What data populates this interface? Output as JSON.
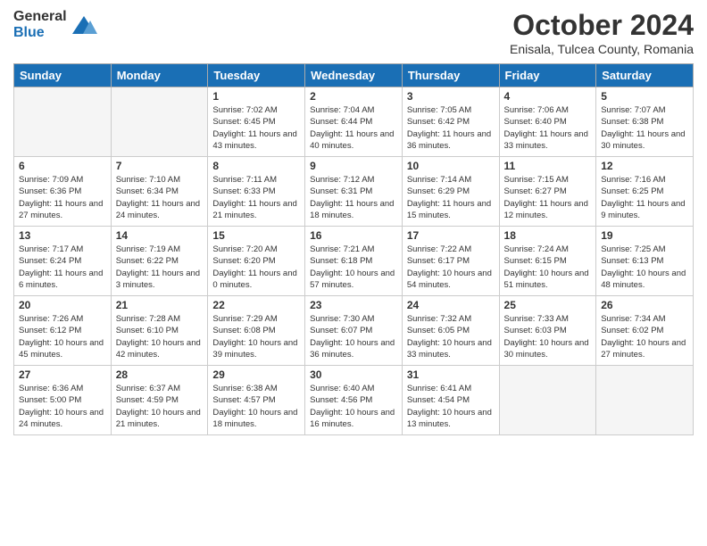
{
  "header": {
    "logo_general": "General",
    "logo_blue": "Blue",
    "month_title": "October 2024",
    "subtitle": "Enisala, Tulcea County, Romania"
  },
  "days_of_week": [
    "Sunday",
    "Monday",
    "Tuesday",
    "Wednesday",
    "Thursday",
    "Friday",
    "Saturday"
  ],
  "weeks": [
    [
      {
        "day": "",
        "sunrise": "",
        "sunset": "",
        "daylight": ""
      },
      {
        "day": "",
        "sunrise": "",
        "sunset": "",
        "daylight": ""
      },
      {
        "day": "1",
        "sunrise": "Sunrise: 7:02 AM",
        "sunset": "Sunset: 6:45 PM",
        "daylight": "Daylight: 11 hours and 43 minutes."
      },
      {
        "day": "2",
        "sunrise": "Sunrise: 7:04 AM",
        "sunset": "Sunset: 6:44 PM",
        "daylight": "Daylight: 11 hours and 40 minutes."
      },
      {
        "day": "3",
        "sunrise": "Sunrise: 7:05 AM",
        "sunset": "Sunset: 6:42 PM",
        "daylight": "Daylight: 11 hours and 36 minutes."
      },
      {
        "day": "4",
        "sunrise": "Sunrise: 7:06 AM",
        "sunset": "Sunset: 6:40 PM",
        "daylight": "Daylight: 11 hours and 33 minutes."
      },
      {
        "day": "5",
        "sunrise": "Sunrise: 7:07 AM",
        "sunset": "Sunset: 6:38 PM",
        "daylight": "Daylight: 11 hours and 30 minutes."
      }
    ],
    [
      {
        "day": "6",
        "sunrise": "Sunrise: 7:09 AM",
        "sunset": "Sunset: 6:36 PM",
        "daylight": "Daylight: 11 hours and 27 minutes."
      },
      {
        "day": "7",
        "sunrise": "Sunrise: 7:10 AM",
        "sunset": "Sunset: 6:34 PM",
        "daylight": "Daylight: 11 hours and 24 minutes."
      },
      {
        "day": "8",
        "sunrise": "Sunrise: 7:11 AM",
        "sunset": "Sunset: 6:33 PM",
        "daylight": "Daylight: 11 hours and 21 minutes."
      },
      {
        "day": "9",
        "sunrise": "Sunrise: 7:12 AM",
        "sunset": "Sunset: 6:31 PM",
        "daylight": "Daylight: 11 hours and 18 minutes."
      },
      {
        "day": "10",
        "sunrise": "Sunrise: 7:14 AM",
        "sunset": "Sunset: 6:29 PM",
        "daylight": "Daylight: 11 hours and 15 minutes."
      },
      {
        "day": "11",
        "sunrise": "Sunrise: 7:15 AM",
        "sunset": "Sunset: 6:27 PM",
        "daylight": "Daylight: 11 hours and 12 minutes."
      },
      {
        "day": "12",
        "sunrise": "Sunrise: 7:16 AM",
        "sunset": "Sunset: 6:25 PM",
        "daylight": "Daylight: 11 hours and 9 minutes."
      }
    ],
    [
      {
        "day": "13",
        "sunrise": "Sunrise: 7:17 AM",
        "sunset": "Sunset: 6:24 PM",
        "daylight": "Daylight: 11 hours and 6 minutes."
      },
      {
        "day": "14",
        "sunrise": "Sunrise: 7:19 AM",
        "sunset": "Sunset: 6:22 PM",
        "daylight": "Daylight: 11 hours and 3 minutes."
      },
      {
        "day": "15",
        "sunrise": "Sunrise: 7:20 AM",
        "sunset": "Sunset: 6:20 PM",
        "daylight": "Daylight: 11 hours and 0 minutes."
      },
      {
        "day": "16",
        "sunrise": "Sunrise: 7:21 AM",
        "sunset": "Sunset: 6:18 PM",
        "daylight": "Daylight: 10 hours and 57 minutes."
      },
      {
        "day": "17",
        "sunrise": "Sunrise: 7:22 AM",
        "sunset": "Sunset: 6:17 PM",
        "daylight": "Daylight: 10 hours and 54 minutes."
      },
      {
        "day": "18",
        "sunrise": "Sunrise: 7:24 AM",
        "sunset": "Sunset: 6:15 PM",
        "daylight": "Daylight: 10 hours and 51 minutes."
      },
      {
        "day": "19",
        "sunrise": "Sunrise: 7:25 AM",
        "sunset": "Sunset: 6:13 PM",
        "daylight": "Daylight: 10 hours and 48 minutes."
      }
    ],
    [
      {
        "day": "20",
        "sunrise": "Sunrise: 7:26 AM",
        "sunset": "Sunset: 6:12 PM",
        "daylight": "Daylight: 10 hours and 45 minutes."
      },
      {
        "day": "21",
        "sunrise": "Sunrise: 7:28 AM",
        "sunset": "Sunset: 6:10 PM",
        "daylight": "Daylight: 10 hours and 42 minutes."
      },
      {
        "day": "22",
        "sunrise": "Sunrise: 7:29 AM",
        "sunset": "Sunset: 6:08 PM",
        "daylight": "Daylight: 10 hours and 39 minutes."
      },
      {
        "day": "23",
        "sunrise": "Sunrise: 7:30 AM",
        "sunset": "Sunset: 6:07 PM",
        "daylight": "Daylight: 10 hours and 36 minutes."
      },
      {
        "day": "24",
        "sunrise": "Sunrise: 7:32 AM",
        "sunset": "Sunset: 6:05 PM",
        "daylight": "Daylight: 10 hours and 33 minutes."
      },
      {
        "day": "25",
        "sunrise": "Sunrise: 7:33 AM",
        "sunset": "Sunset: 6:03 PM",
        "daylight": "Daylight: 10 hours and 30 minutes."
      },
      {
        "day": "26",
        "sunrise": "Sunrise: 7:34 AM",
        "sunset": "Sunset: 6:02 PM",
        "daylight": "Daylight: 10 hours and 27 minutes."
      }
    ],
    [
      {
        "day": "27",
        "sunrise": "Sunrise: 6:36 AM",
        "sunset": "Sunset: 5:00 PM",
        "daylight": "Daylight: 10 hours and 24 minutes."
      },
      {
        "day": "28",
        "sunrise": "Sunrise: 6:37 AM",
        "sunset": "Sunset: 4:59 PM",
        "daylight": "Daylight: 10 hours and 21 minutes."
      },
      {
        "day": "29",
        "sunrise": "Sunrise: 6:38 AM",
        "sunset": "Sunset: 4:57 PM",
        "daylight": "Daylight: 10 hours and 18 minutes."
      },
      {
        "day": "30",
        "sunrise": "Sunrise: 6:40 AM",
        "sunset": "Sunset: 4:56 PM",
        "daylight": "Daylight: 10 hours and 16 minutes."
      },
      {
        "day": "31",
        "sunrise": "Sunrise: 6:41 AM",
        "sunset": "Sunset: 4:54 PM",
        "daylight": "Daylight: 10 hours and 13 minutes."
      },
      {
        "day": "",
        "sunrise": "",
        "sunset": "",
        "daylight": ""
      },
      {
        "day": "",
        "sunrise": "",
        "sunset": "",
        "daylight": ""
      }
    ]
  ]
}
